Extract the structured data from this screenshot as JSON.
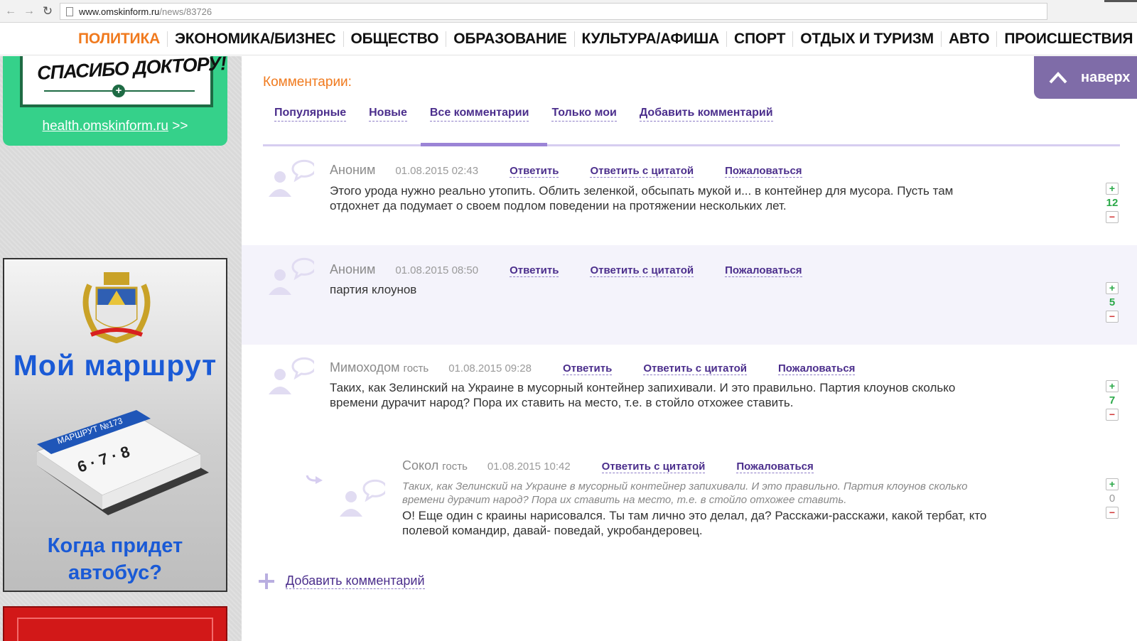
{
  "browser": {
    "url_domain": "www.omskinform.ru",
    "url_path": "/news/83726"
  },
  "nav": {
    "items": [
      {
        "label": "ПОЛИТИКА",
        "active": true
      },
      {
        "label": "ЭКОНОМИКА/БИЗНЕС"
      },
      {
        "label": "ОБЩЕСТВО"
      },
      {
        "label": "ОБРАЗОВАНИЕ"
      },
      {
        "label": "КУЛЬТУРА/АФИША"
      },
      {
        "label": "СПОРТ"
      },
      {
        "label": "ОТДЫХ И ТУРИЗМ"
      },
      {
        "label": "АВТО"
      },
      {
        "label": "ПРОИСШЕСТВИЯ"
      }
    ]
  },
  "sidebar": {
    "doctor_banner_text": "СПАСИБО ДОКТОРУ!",
    "health_link": "health.omskinform.ru",
    "health_link_suffix": " >>",
    "route_title": "Мой маршрут",
    "route_subtitle_1": "Когда придет",
    "route_subtitle_2": "автобус?",
    "calendar_label": "МАРШРУТ №173"
  },
  "to_top": {
    "label": "наверх"
  },
  "comments": {
    "title": "Комментарии:",
    "tabs": [
      "Популярные",
      "Новые",
      "Все комментарии",
      "Только мои",
      "Добавить комментарий"
    ],
    "items": [
      {
        "author": "Аноним",
        "guest": "",
        "date": "01.08.2015 02:43",
        "actions": [
          "Ответить",
          "Ответить с цитатой",
          "Пожаловаться"
        ],
        "text_1": "Этого урода нужно реально утопить. Облить зеленкой, обсыпать мукой и... в контейнер для мусора. Пусть там",
        "text_2": "отдохнет да подумает о своем подлом поведении на протяжении нескольких лет.",
        "rating": "12"
      },
      {
        "author": "Аноним",
        "guest": "",
        "date": "01.08.2015 08:50",
        "actions": [
          "Ответить",
          "Ответить с цитатой",
          "Пожаловаться"
        ],
        "text_1": "партия клоунов",
        "rating": "5"
      },
      {
        "author": "Мимоходом",
        "guest": "гость",
        "date": "01.08.2015 09:28",
        "actions": [
          "Ответить",
          "Ответить с цитатой",
          "Пожаловаться"
        ],
        "text_1": "Таких, как Зелинский на Украине в мусорный контейнер запихивали. И это правильно. Партия клоунов сколько",
        "text_2": "времени дурачит народ? Пора их ставить на место, т.е. в стойло отхожее ставить.",
        "rating": "7"
      },
      {
        "author": "Сокол",
        "guest": "гость",
        "date": "01.08.2015 10:42",
        "actions": [
          "Ответить с цитатой",
          "Пожаловаться"
        ],
        "quote_1": "Таких, как Зелинский на Украине в мусорный контейнер запихивали. И это правильно. Партия клоунов сколько",
        "quote_2": "времени дурачит народ? Пора их ставить на место, т.е. в стойло отхожее ставить.",
        "text_1": "О! Еще один с краины нарисовался. Ты там лично это делал, да? Расскажи-расскажи, какой тербат, кто",
        "text_2": "полевой командир, давай- поведай, укробандеровец.",
        "rating": "0"
      }
    ],
    "add_comment": "Добавить комментарий"
  },
  "colors": {
    "accent_orange": "#f07a1e",
    "link_purple": "#4b2e8c",
    "green": "#2aa848",
    "sidebar_green": "#35d18a",
    "route_blue": "#1a5ad6"
  }
}
